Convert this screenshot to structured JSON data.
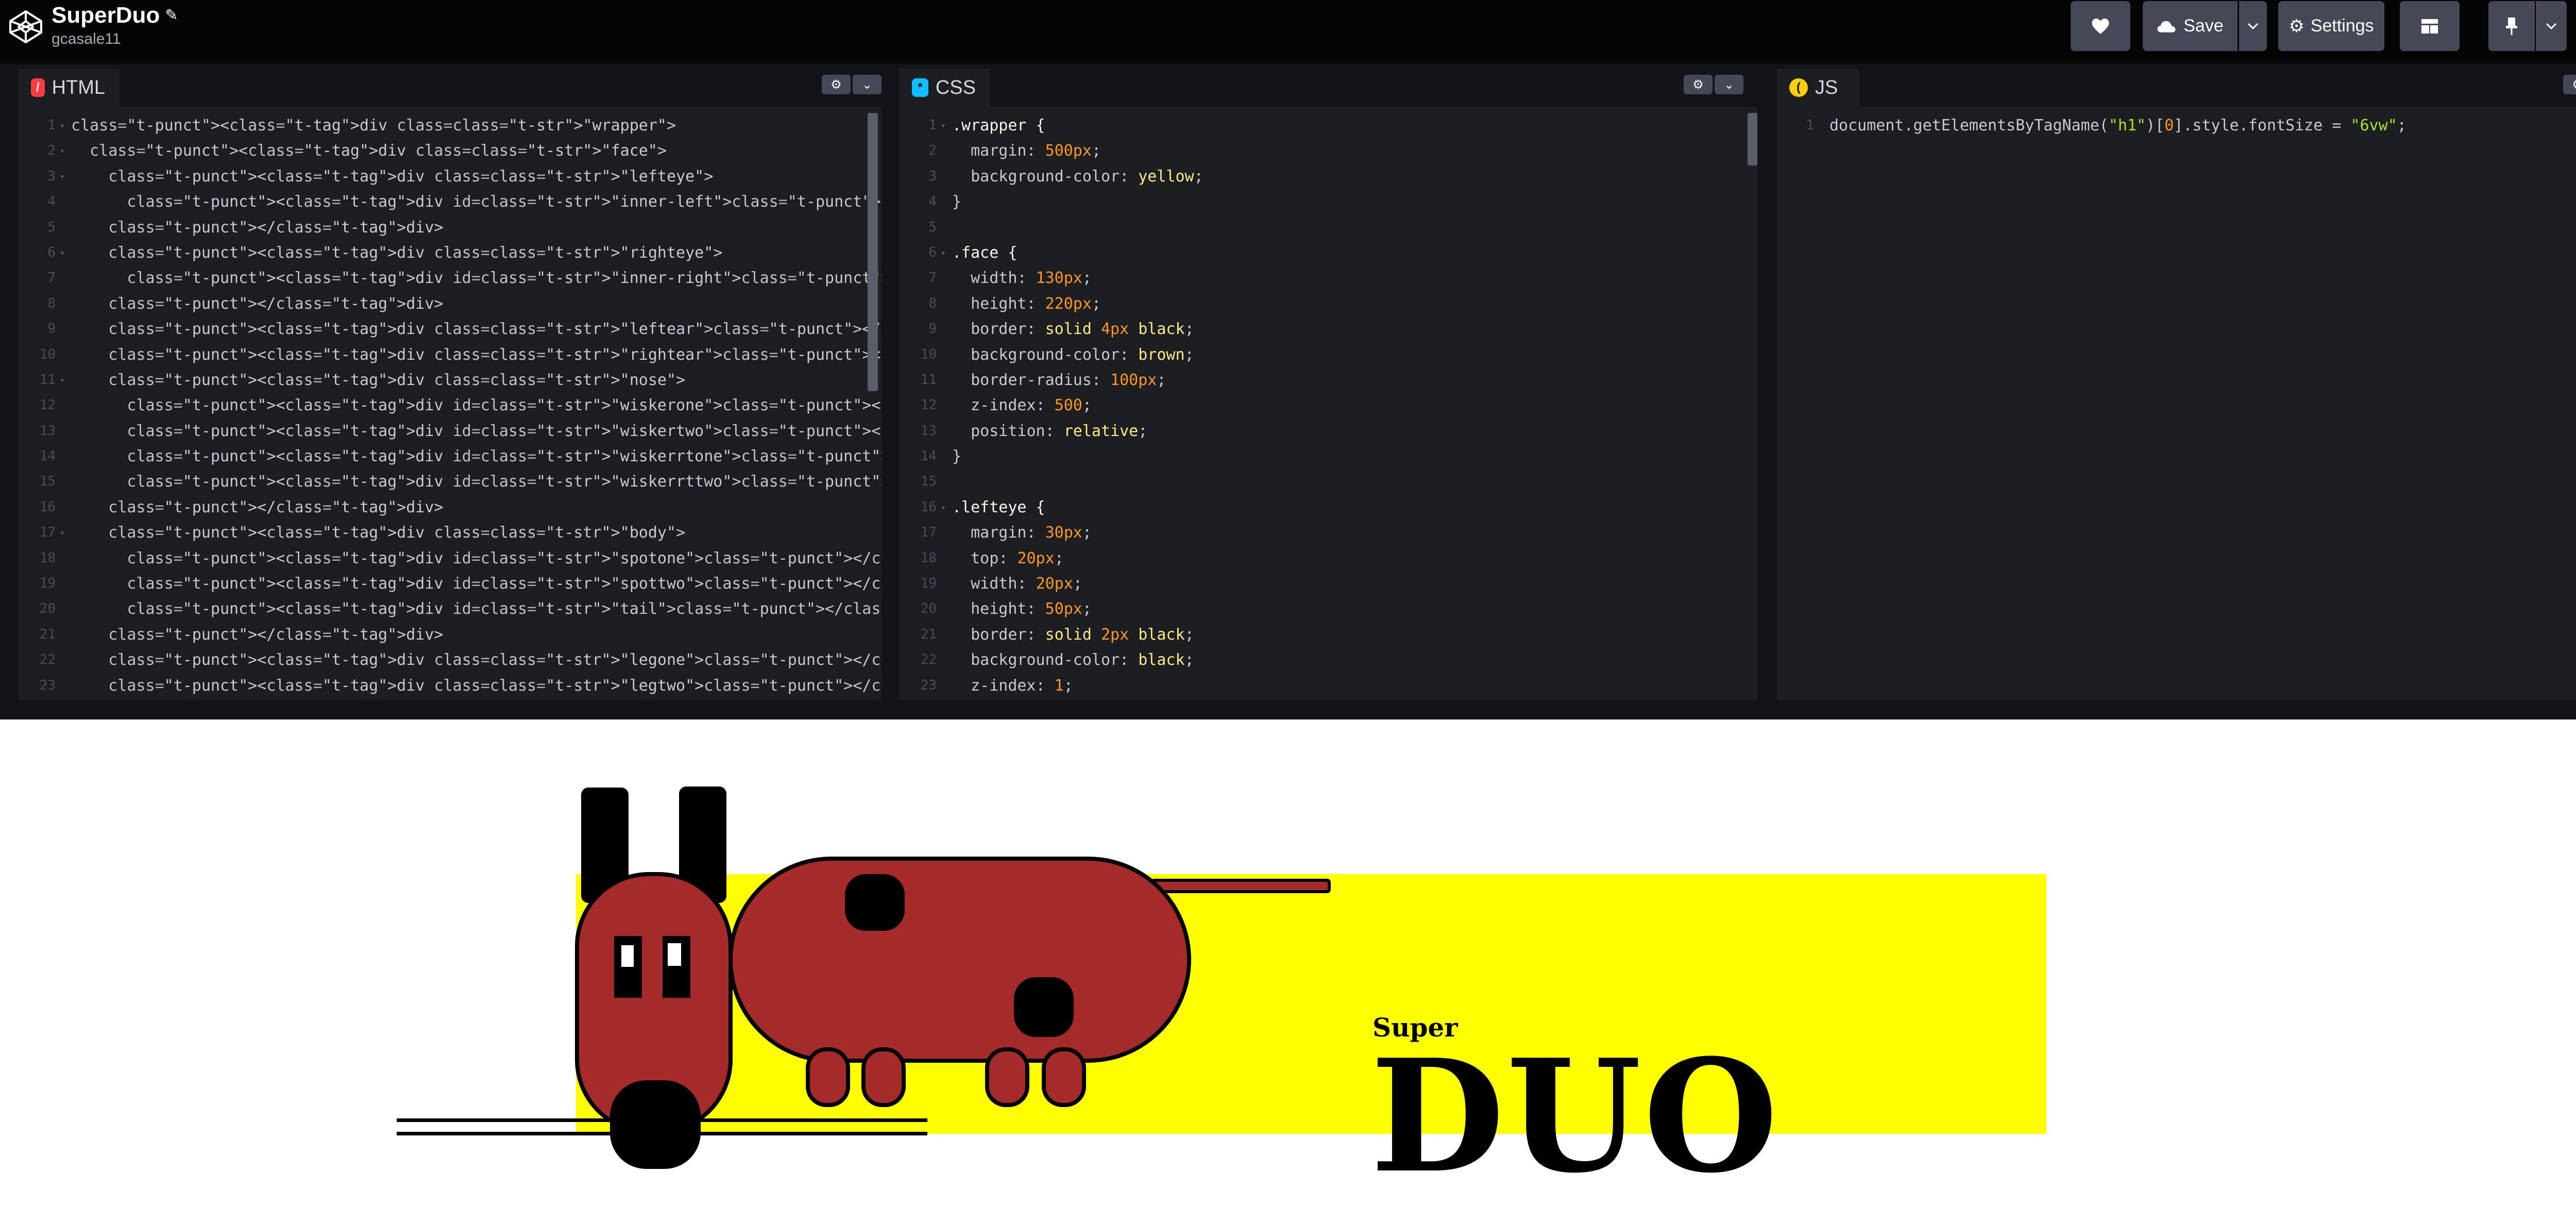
{
  "app": {
    "title": "SuperDuo",
    "author": "gcasale11",
    "buttons": {
      "save": "Save",
      "settings": "Settings"
    },
    "icons": {
      "logo": "codepen-logo-icon",
      "edit": "pencil-icon",
      "heart": "heart-icon",
      "save": "cloud-icon",
      "settings": "gear-icon",
      "layout": "layout-grid-icon",
      "pin": "pin-icon"
    },
    "accent_color": "#47cf73"
  },
  "editors": {
    "html": {
      "tab": "HTML",
      "badge_color": "#ff3c41",
      "lines": [
        "<div class=\"wrapper\">",
        "  <div class=\"face\">",
        "    <div class=\"lefteye\">",
        "      <div id=\"inner-left\"></div>",
        "    </div>",
        "    <div class=\"righteye\">",
        "      <div id=\"inner-right\"></div>",
        "    </div>",
        "    <div class=\"leftear\"></div>",
        "    <div class=\"rightear\"></div>",
        "    <div class=\"nose\">",
        "      <div id=\"wiskerone\"></div>",
        "      <div id=\"wiskertwo\"></div>",
        "      <div id=\"wiskerrtone\"></div>",
        "      <div id=\"wiskerrttwo\"></div>",
        "    </div>",
        "    <div class=\"body\">",
        "      <div id=\"spotone\"></div>",
        "      <div id=\"spottwo\"></div>",
        "      <div id=\"tail\"></div>",
        "    </div>",
        "    <div class=\"legone\"></div>",
        "    <div class=\"legtwo\"></div>"
      ],
      "fold_lines": [
        1,
        2,
        3,
        6,
        11,
        17
      ]
    },
    "css": {
      "tab": "CSS",
      "badge_color": "#0ebeff",
      "lines": [
        ".wrapper {",
        "  margin: 500px;",
        "  background-color: yellow;",
        "}",
        "",
        ".face {",
        "  width: 130px;",
        "  height: 220px;",
        "  border: solid 4px black;",
        "  background-color: brown;",
        "  border-radius: 100px;",
        "  z-index: 500;",
        "  position: relative;",
        "}",
        "",
        ".lefteye {",
        "  margin: 30px;",
        "  top: 20px;",
        "  width: 20px;",
        "  height: 50px;",
        "  border: solid 2px black;",
        "  background-color: black;",
        "  z-index: 1;"
      ],
      "fold_lines": [
        1,
        6,
        16
      ]
    },
    "js": {
      "tab": "JS",
      "badge_color": "#fcd000",
      "lines": [
        "document.getElementsByTagName(\"h1\")[0].style.fontSize = \"6vw\";"
      ],
      "fold_lines": []
    }
  },
  "result": {
    "super": "Super",
    "duo": "DUO",
    "banner_color": "#ffff00",
    "dog_color": "#a52a2a"
  }
}
